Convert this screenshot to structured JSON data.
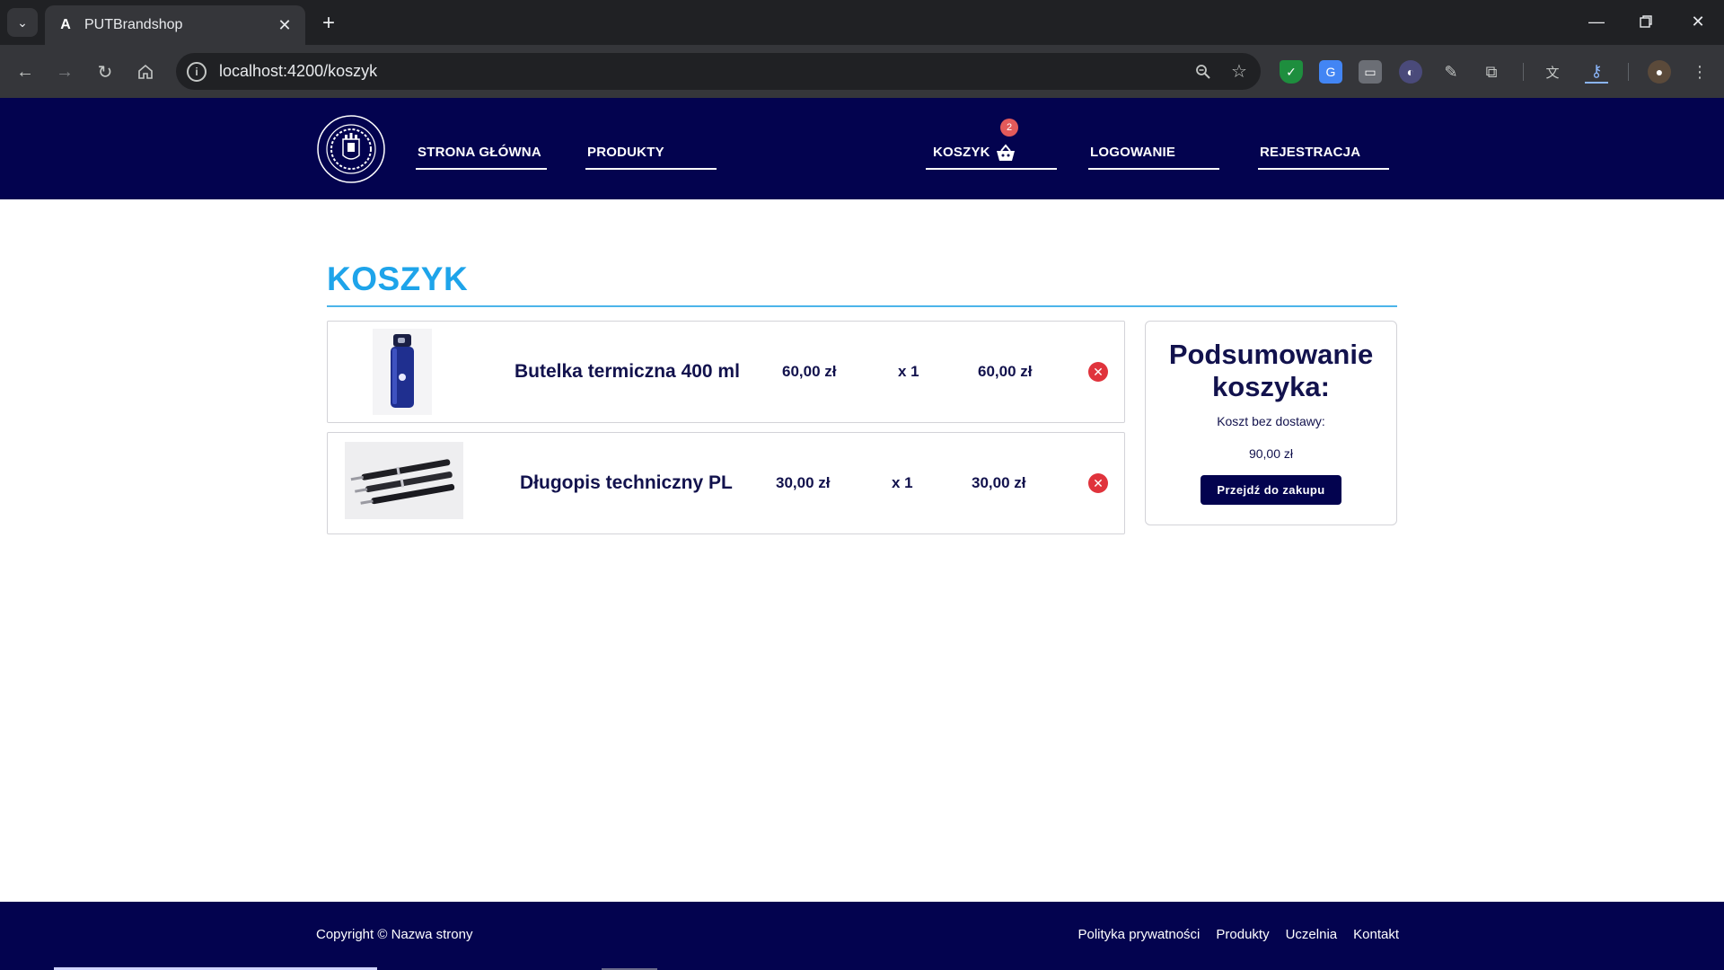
{
  "browser": {
    "tab_title": "PUTBrandshop",
    "tab_favicon": "A",
    "url": "localhost:4200/koszyk",
    "icons": [
      "tab-search-icon",
      "angular-favicon-icon",
      "close-icon",
      "new-tab-icon",
      "minimize-icon",
      "restore-icon",
      "window-close-icon",
      "back-icon",
      "forward-icon",
      "reload-icon",
      "home-icon",
      "site-info-icon",
      "zoom-icon",
      "bookmark-star-icon",
      "shield-extension-icon",
      "translate-extension-icon",
      "printer-extension-icon",
      "dark-extension-icon",
      "eyedropper-icon",
      "extensions-puzzle-icon",
      "translate-icon",
      "password-key-icon",
      "profile-avatar-icon",
      "menu-dots-icon"
    ]
  },
  "header": {
    "nav": {
      "home": "STRONA GŁÓWNA",
      "products": "PRODUKTY",
      "cart": "KOSZYK",
      "login": "LOGOWANIE",
      "register": "REJESTRACJA"
    },
    "cart_count": "2",
    "colors": {
      "background": "#03034f",
      "badge": "#e35a5a"
    }
  },
  "main": {
    "title": "KOSZYK",
    "items": [
      {
        "name": "Butelka termiczna 400 ml",
        "price": "60,00 zł",
        "qty": "x 1",
        "total": "60,00 zł",
        "image": "thermal-bottle-image"
      },
      {
        "name": "Długopis techniczny PL",
        "price": "30,00 zł",
        "qty": "x 1",
        "total": "30,00 zł",
        "image": "pens-image"
      }
    ],
    "colors": {
      "title": "#1ea4ea",
      "text": "#12124d",
      "remove": "#e0333c"
    }
  },
  "summary": {
    "title": "Podsumowanie koszyka:",
    "label": "Koszt bez dostawy:",
    "value": "90,00 zł",
    "button": "Przejdź do zakupu"
  },
  "footer": {
    "copyright": "Copyright © Nazwa strony",
    "links": [
      "Polityka prywatności",
      "Produkty",
      "Uczelnia",
      "Kontakt"
    ]
  }
}
